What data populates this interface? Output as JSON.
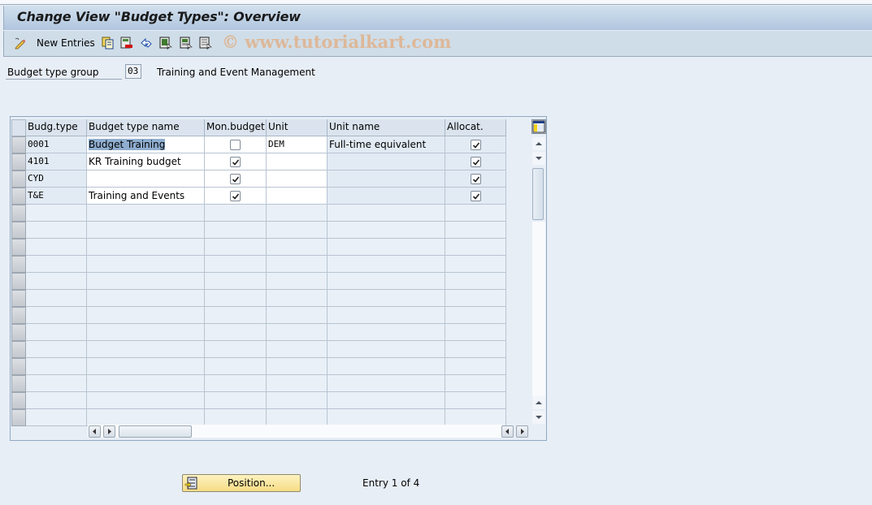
{
  "window": {
    "title": "Change View \"Budget Types\": Overview"
  },
  "toolbar": {
    "new_entries_label": "New Entries",
    "icons": [
      "edit-pencil-icon",
      "copy-icon",
      "delete-icon",
      "undo-icon",
      "select-all-icon",
      "select-block-icon",
      "deselect-all-icon"
    ],
    "watermark": "© www.tutorialkart.com"
  },
  "header_field": {
    "label": "Budget type group",
    "value": "03",
    "description": "Training and Event Management"
  },
  "table": {
    "columns": [
      "Budg.type",
      "Budget type name",
      "Mon.budget",
      "Unit",
      "Unit name",
      "Allocat."
    ],
    "rows": [
      {
        "budg_type": "0001",
        "name": "Budget Training",
        "mon_budget": false,
        "unit": "DEM",
        "unit_name": "Full-time equivalent",
        "allocat": true
      },
      {
        "budg_type": "4101",
        "name": "KR Training budget",
        "mon_budget": true,
        "unit": "",
        "unit_name": "",
        "allocat": true
      },
      {
        "budg_type": "CYD",
        "name": "",
        "mon_budget": true,
        "unit": "",
        "unit_name": "",
        "allocat": true
      },
      {
        "budg_type": "T&E",
        "name": "Training and Events",
        "mon_budget": true,
        "unit": "",
        "unit_name": "",
        "allocat": true
      }
    ],
    "empty_rows": 13
  },
  "footer": {
    "position_button_label": "Position...",
    "entry_text": "Entry 1 of 4"
  }
}
